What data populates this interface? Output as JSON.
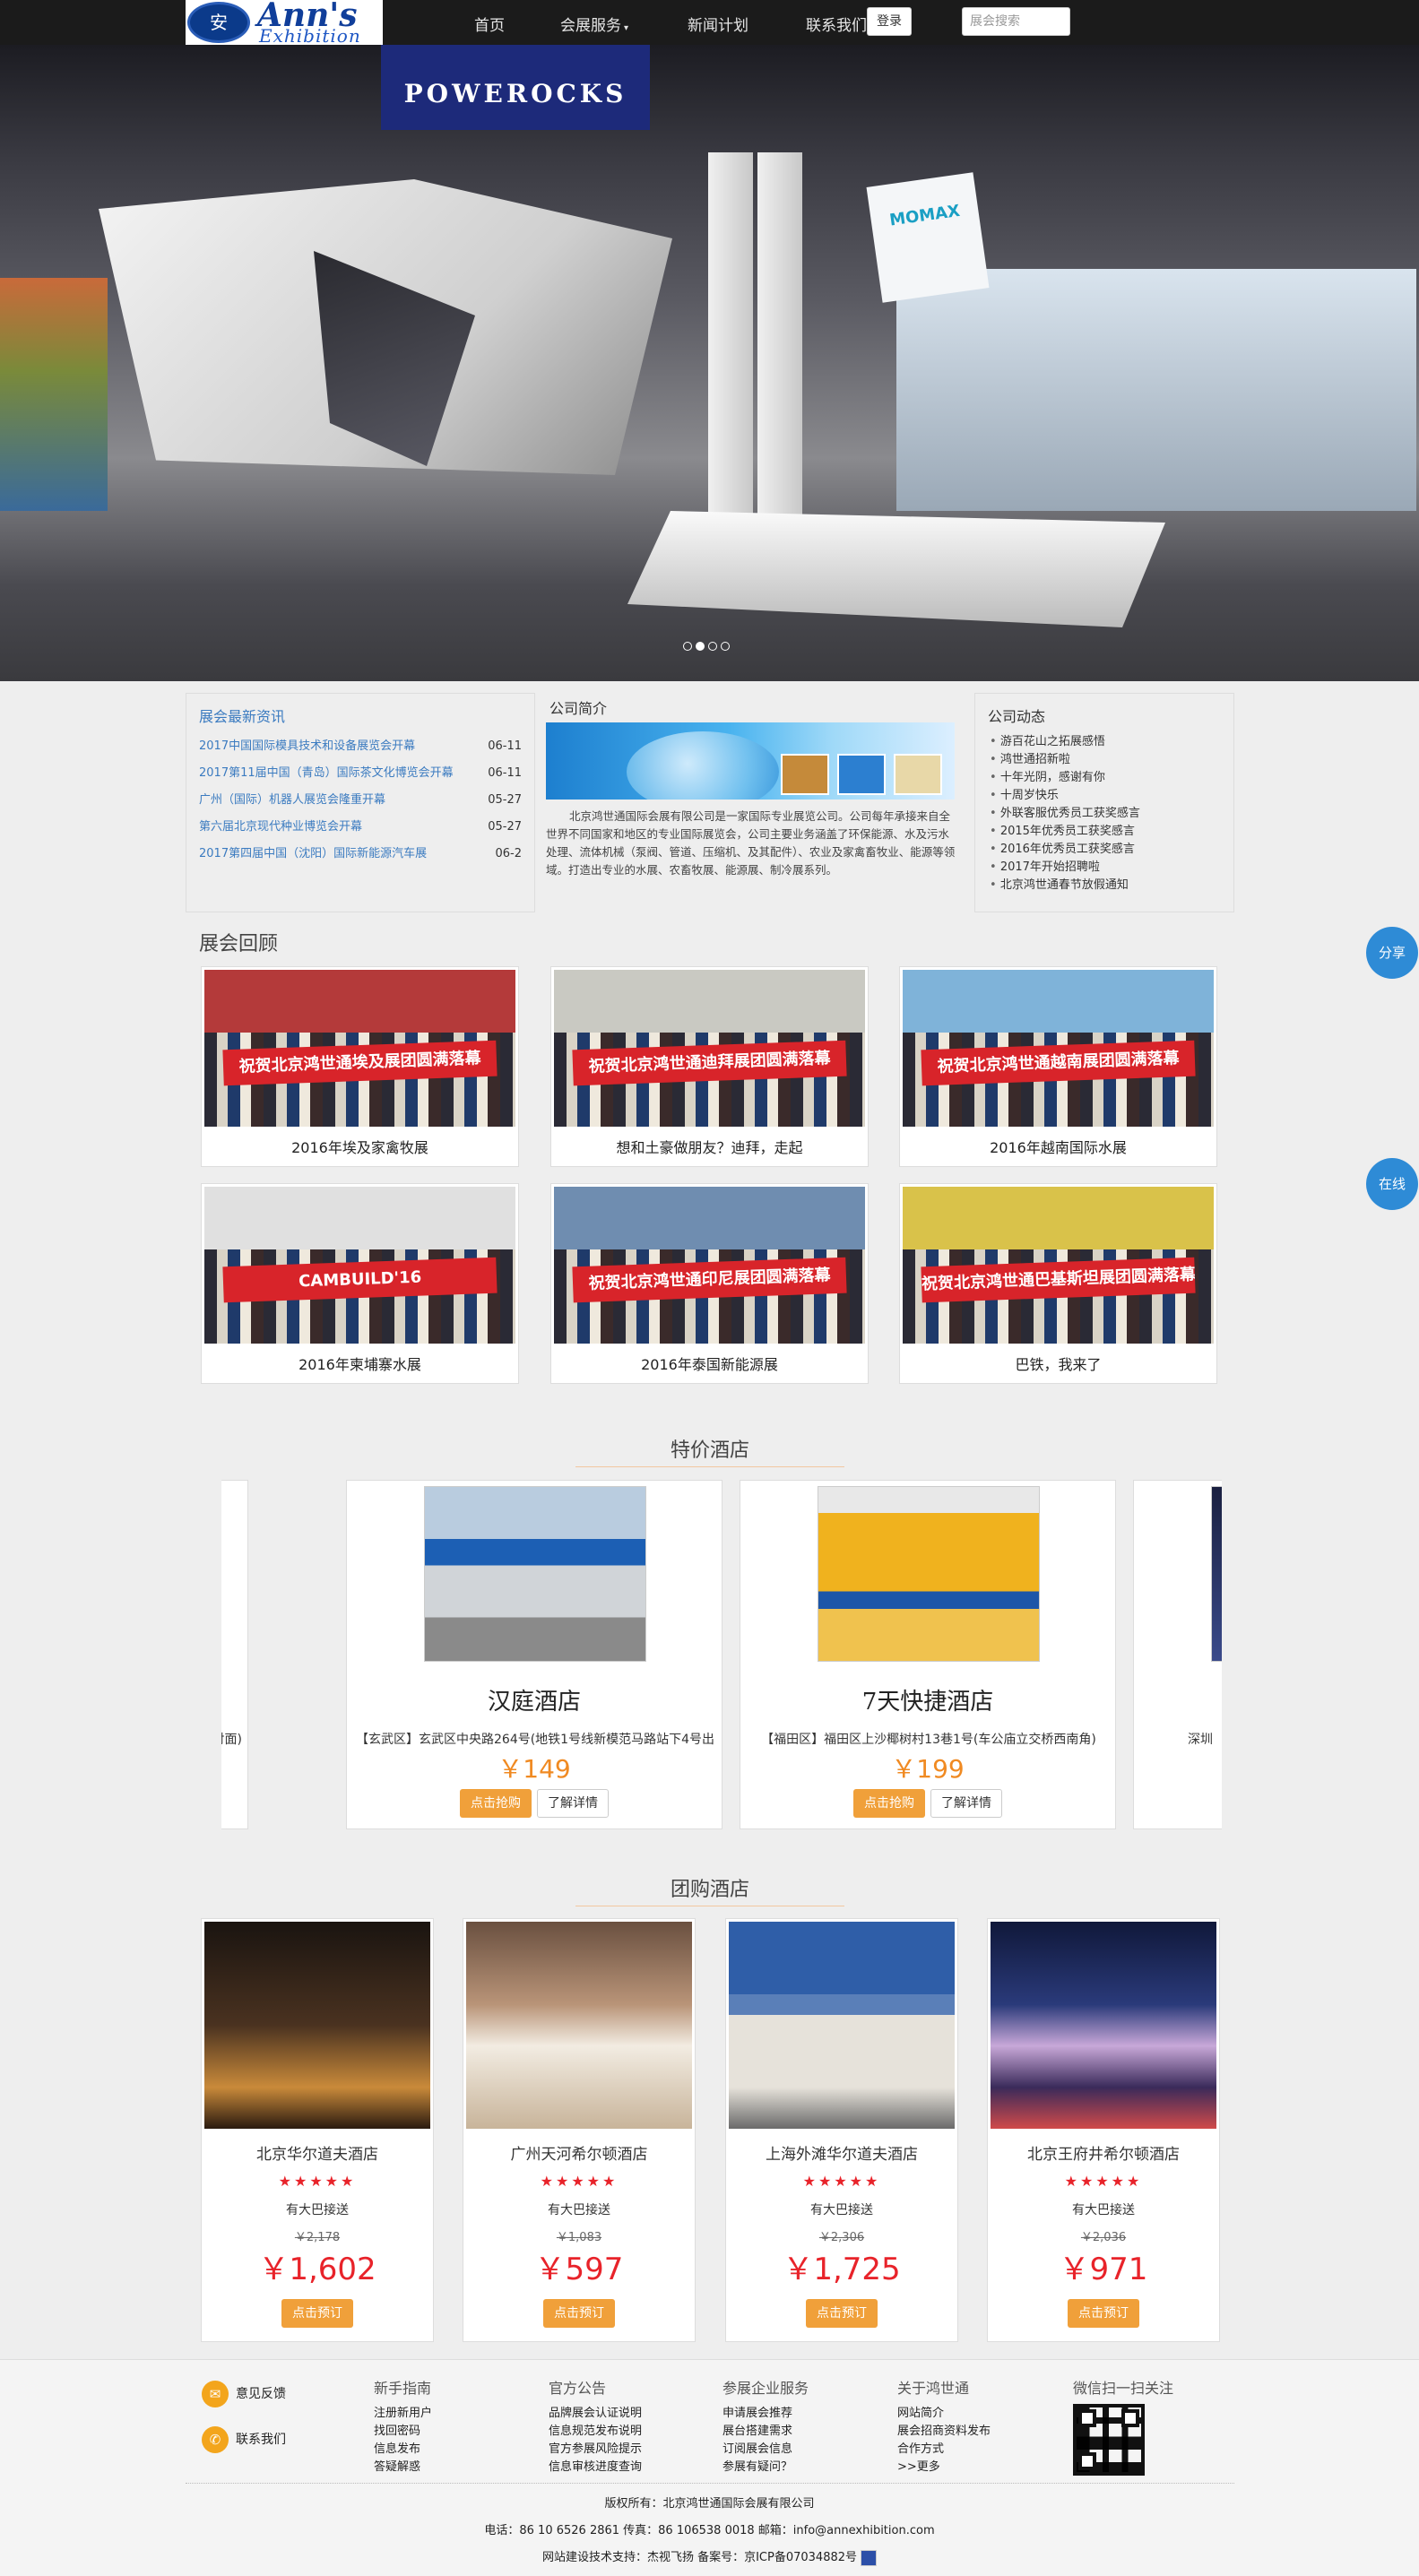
{
  "nav": {
    "logo_mark": "安",
    "logo_line1": "Ann's",
    "logo_line2": "Exhibition",
    "items": [
      {
        "label": "首页"
      },
      {
        "label": "会展服务"
      },
      {
        "label": "新闻计划"
      },
      {
        "label": "联系我们"
      }
    ],
    "login_label": "登录",
    "search_placeholder": "展会搜索"
  },
  "hero": {
    "banner_text": "POWEROCKS",
    "booth_sign": "MOMAX",
    "slide_count": 4,
    "active_slide": 2
  },
  "news": {
    "title": "展会最新资讯",
    "items": [
      {
        "title": "2017中国国际模具技术和设备展览会开幕",
        "date": "06-11"
      },
      {
        "title": "2017第11届中国（青岛）国际茶文化博览会开幕",
        "date": "06-11"
      },
      {
        "title": "广州（国际）机器人展览会隆重开幕",
        "date": "05-27"
      },
      {
        "title": "第六届北京现代种业博览会开幕",
        "date": "05-27"
      },
      {
        "title": "2017第四届中国（沈阳）国际新能源汽车展",
        "date": "06-2"
      }
    ]
  },
  "intro": {
    "title": "公司简介",
    "text": "北京鸿世通国际会展有限公司是一家国际专业展览公司。公司每年承接来自全世界不同国家和地区的专业国际展览会，公司主要业务涵盖了环保能源、水及污水处理、流体机械（泵阀、管道、压缩机、及其配件）、农业及家禽畜牧业、能源等领域。打造出专业的水展、农畜牧展、能源展、制冷展系列。"
  },
  "dynamics": {
    "title": "公司动态",
    "items": [
      "游百花山之拓展感悟",
      "鸿世通招新啦",
      "十年光阴，感谢有你",
      "十周岁快乐",
      "外联客服优秀员工获奖感言",
      "2015年优秀员工获奖感言",
      "2016年优秀员工获奖感言",
      "2017年开始招聘啦",
      "北京鸿世通春节放假通知"
    ]
  },
  "expo_review": {
    "title": "展会回顾",
    "items": [
      {
        "caption": "2016年埃及家禽牧展",
        "banner": "祝贺北京鸿世通埃及展团圆满落幕",
        "sky": "#b43a3a"
      },
      {
        "caption": "想和土豪做朋友？迪拜，走起",
        "banner": "祝贺北京鸿世通迪拜展团圆满落幕",
        "sky": "#c9c9c2"
      },
      {
        "caption": "2016年越南国际水展",
        "banner": "祝贺北京鸿世通越南展团圆满落幕",
        "sky": "#7fb3d9"
      },
      {
        "caption": "2016年柬埔寨水展",
        "banner": "CAMBUILD'16",
        "sky": "#e0e0e0"
      },
      {
        "caption": "2016年泰国新能源展",
        "banner": "祝贺北京鸿世通印尼展团圆满落幕",
        "sky": "#6f8db0"
      },
      {
        "caption": "巴铁，我来了",
        "banner": "祝贺北京鸿世通巴基斯坦展团圆满落幕",
        "sky": "#d9c24a"
      }
    ]
  },
  "special_hotels": {
    "title": "特价酒店",
    "left_partial_addr": "马路斜对面)",
    "right_partial_addr": "深圳",
    "items": [
      {
        "name": "汉庭酒店",
        "address": "【玄武区】玄武区中央路264号(地铁1号线新模范马路站下4号出",
        "price": "￥149",
        "book_label": "点击抢购",
        "detail_label": "了解详情",
        "color": "#1c5fb4"
      },
      {
        "name": "7天快捷酒店",
        "address": "【福田区】福田区上沙椰树村13巷1号(车公庙立交桥西南角)",
        "price": "￥199",
        "book_label": "点击抢购",
        "detail_label": "了解详情",
        "color": "#f0b21e"
      }
    ]
  },
  "group_hotels": {
    "title": "团购酒店",
    "items": [
      {
        "name": "北京华尔道夫酒店",
        "stars": "★★★★★",
        "note": "有大巴接送",
        "original": "￥2,178",
        "price": "￥1,602",
        "button": "点击预订",
        "tone": "#3a2a1c"
      },
      {
        "name": "广州天河希尔顿酒店",
        "stars": "★★★★★",
        "note": "有大巴接送",
        "original": "￥1,083",
        "price": "￥597",
        "button": "点击预订",
        "tone": "#8a6a4a"
      },
      {
        "name": "上海外滩华尔道夫酒店",
        "stars": "★★★★★",
        "note": "有大巴接送",
        "original": "￥2,306",
        "price": "￥1,725",
        "button": "点击预订",
        "tone": "#3a66a8"
      },
      {
        "name": "北京王府井希尔顿酒店",
        "stars": "★★★★★",
        "note": "有大巴接送",
        "original": "￥2,036",
        "price": "￥971",
        "button": "点击预订",
        "tone": "#1b2a6a"
      }
    ]
  },
  "float": {
    "share": "分享",
    "online": "在线"
  },
  "footer": {
    "feedback": "意见反馈",
    "contact": "联系我们",
    "columns": [
      {
        "title": "新手指南",
        "links": [
          "注册新用户",
          "找回密码",
          "信息发布",
          "答疑解惑"
        ]
      },
      {
        "title": "官方公告",
        "links": [
          "品牌展会认证说明",
          "信息规范发布说明",
          "官方参展风险提示",
          "信息审核进度查询"
        ]
      },
      {
        "title": "参展企业服务",
        "links": [
          "申请展会推荐",
          "展台搭建需求",
          "订阅展会信息",
          "参展有疑问？"
        ]
      },
      {
        "title": "关于鸿世通",
        "links": [
          "网站简介",
          "展会招商资料发布",
          "合作方式",
          ">>更多"
        ]
      }
    ],
    "wechat_title": "微信扫一扫关注",
    "copyright": "版权所有：北京鸿世通国际会展有限公司",
    "contact_line": "电话：86 10 6526 2861 传真：86 106538 0018 邮箱：info@annexhibition.com",
    "support_line": "网站建设技术支持：杰视飞扬 备案号：京ICP备07034882号"
  }
}
